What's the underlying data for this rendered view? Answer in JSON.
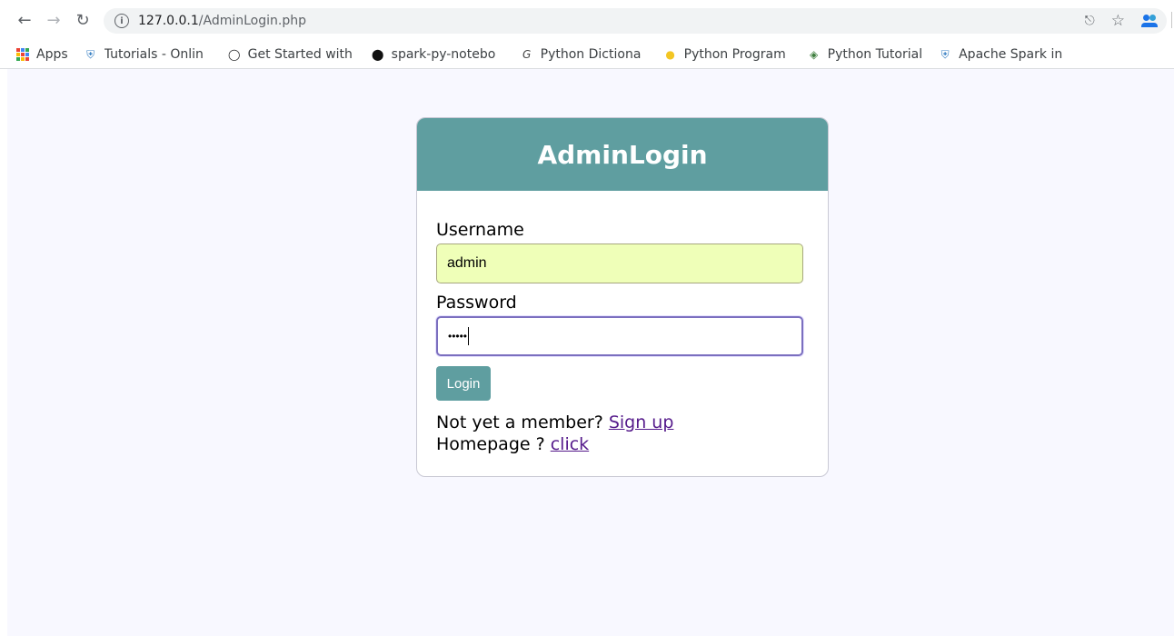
{
  "browser": {
    "url_host": "127.0.0.1",
    "url_path": "/AdminLogin.php",
    "back_icon": "arrow-left-icon",
    "forward_icon": "arrow-right-icon",
    "reload_icon": "reload-icon",
    "bookmarks": [
      {
        "label": "Apps",
        "icon": "apps-grid-icon"
      },
      {
        "label": "Tutorials - Onlin",
        "icon": "shield-icon"
      },
      {
        "label": "Get Started with",
        "icon": "circle-logo-icon"
      },
      {
        "label": "spark-py-notebo",
        "icon": "github-icon"
      },
      {
        "label": "Python Dictiona",
        "icon": "g-logo-icon"
      },
      {
        "label": "Python Program",
        "icon": "python-icon"
      },
      {
        "label": "Python Tutorial",
        "icon": "diamond-icon"
      },
      {
        "label": "Apache Spark in",
        "icon": "shield-icon"
      }
    ]
  },
  "login": {
    "title": "AdminLogin",
    "username_label": "Username",
    "username_value": "admin",
    "password_label": "Password",
    "password_value": "•••••",
    "login_button": "Login",
    "member_text": "Not yet a member? ",
    "signup_link": "Sign up",
    "homepage_text": "Homepage ? ",
    "homepage_link": "click"
  },
  "colors": {
    "header": "#5f9ea0",
    "page_bg": "#f8f8ff",
    "link": "#551a8b",
    "autofill": "#efffb8"
  }
}
